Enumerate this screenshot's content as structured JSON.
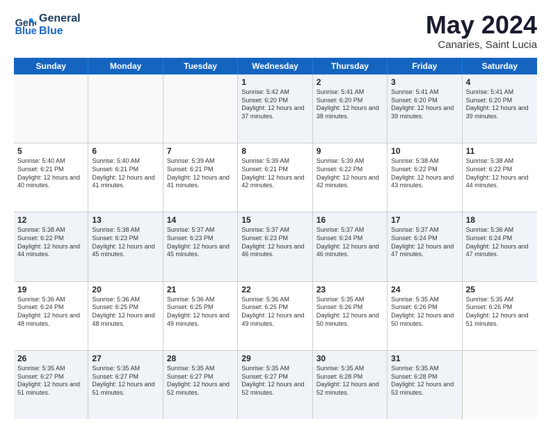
{
  "logo": {
    "text1": "General",
    "text2": "Blue"
  },
  "title": "May 2024",
  "subtitle": "Canaries, Saint Lucia",
  "days": [
    "Sunday",
    "Monday",
    "Tuesday",
    "Wednesday",
    "Thursday",
    "Friday",
    "Saturday"
  ],
  "rows": [
    [
      {
        "day": "",
        "sunrise": "",
        "sunset": "",
        "daylight": "",
        "empty": true
      },
      {
        "day": "",
        "sunrise": "",
        "sunset": "",
        "daylight": "",
        "empty": true
      },
      {
        "day": "",
        "sunrise": "",
        "sunset": "",
        "daylight": "",
        "empty": true
      },
      {
        "day": "1",
        "sunrise": "Sunrise: 5:42 AM",
        "sunset": "Sunset: 6:20 PM",
        "daylight": "Daylight: 12 hours and 37 minutes."
      },
      {
        "day": "2",
        "sunrise": "Sunrise: 5:41 AM",
        "sunset": "Sunset: 6:20 PM",
        "daylight": "Daylight: 12 hours and 38 minutes."
      },
      {
        "day": "3",
        "sunrise": "Sunrise: 5:41 AM",
        "sunset": "Sunset: 6:20 PM",
        "daylight": "Daylight: 12 hours and 39 minutes."
      },
      {
        "day": "4",
        "sunrise": "Sunrise: 5:41 AM",
        "sunset": "Sunset: 6:20 PM",
        "daylight": "Daylight: 12 hours and 39 minutes."
      }
    ],
    [
      {
        "day": "5",
        "sunrise": "Sunrise: 5:40 AM",
        "sunset": "Sunset: 6:21 PM",
        "daylight": "Daylight: 12 hours and 40 minutes."
      },
      {
        "day": "6",
        "sunrise": "Sunrise: 5:40 AM",
        "sunset": "Sunset: 6:21 PM",
        "daylight": "Daylight: 12 hours and 41 minutes."
      },
      {
        "day": "7",
        "sunrise": "Sunrise: 5:39 AM",
        "sunset": "Sunset: 6:21 PM",
        "daylight": "Daylight: 12 hours and 41 minutes."
      },
      {
        "day": "8",
        "sunrise": "Sunrise: 5:39 AM",
        "sunset": "Sunset: 6:21 PM",
        "daylight": "Daylight: 12 hours and 42 minutes."
      },
      {
        "day": "9",
        "sunrise": "Sunrise: 5:39 AM",
        "sunset": "Sunset: 6:22 PM",
        "daylight": "Daylight: 12 hours and 42 minutes."
      },
      {
        "day": "10",
        "sunrise": "Sunrise: 5:38 AM",
        "sunset": "Sunset: 6:22 PM",
        "daylight": "Daylight: 12 hours and 43 minutes."
      },
      {
        "day": "11",
        "sunrise": "Sunrise: 5:38 AM",
        "sunset": "Sunset: 6:22 PM",
        "daylight": "Daylight: 12 hours and 44 minutes."
      }
    ],
    [
      {
        "day": "12",
        "sunrise": "Sunrise: 5:38 AM",
        "sunset": "Sunset: 6:22 PM",
        "daylight": "Daylight: 12 hours and 44 minutes."
      },
      {
        "day": "13",
        "sunrise": "Sunrise: 5:38 AM",
        "sunset": "Sunset: 6:23 PM",
        "daylight": "Daylight: 12 hours and 45 minutes."
      },
      {
        "day": "14",
        "sunrise": "Sunrise: 5:37 AM",
        "sunset": "Sunset: 6:23 PM",
        "daylight": "Daylight: 12 hours and 45 minutes."
      },
      {
        "day": "15",
        "sunrise": "Sunrise: 5:37 AM",
        "sunset": "Sunset: 6:23 PM",
        "daylight": "Daylight: 12 hours and 46 minutes."
      },
      {
        "day": "16",
        "sunrise": "Sunrise: 5:37 AM",
        "sunset": "Sunset: 6:24 PM",
        "daylight": "Daylight: 12 hours and 46 minutes."
      },
      {
        "day": "17",
        "sunrise": "Sunrise: 5:37 AM",
        "sunset": "Sunset: 6:24 PM",
        "daylight": "Daylight: 12 hours and 47 minutes."
      },
      {
        "day": "18",
        "sunrise": "Sunrise: 5:36 AM",
        "sunset": "Sunset: 6:24 PM",
        "daylight": "Daylight: 12 hours and 47 minutes."
      }
    ],
    [
      {
        "day": "19",
        "sunrise": "Sunrise: 5:36 AM",
        "sunset": "Sunset: 6:24 PM",
        "daylight": "Daylight: 12 hours and 48 minutes."
      },
      {
        "day": "20",
        "sunrise": "Sunrise: 5:36 AM",
        "sunset": "Sunset: 6:25 PM",
        "daylight": "Daylight: 12 hours and 48 minutes."
      },
      {
        "day": "21",
        "sunrise": "Sunrise: 5:36 AM",
        "sunset": "Sunset: 6:25 PM",
        "daylight": "Daylight: 12 hours and 49 minutes."
      },
      {
        "day": "22",
        "sunrise": "Sunrise: 5:36 AM",
        "sunset": "Sunset: 6:25 PM",
        "daylight": "Daylight: 12 hours and 49 minutes."
      },
      {
        "day": "23",
        "sunrise": "Sunrise: 5:35 AM",
        "sunset": "Sunset: 6:26 PM",
        "daylight": "Daylight: 12 hours and 50 minutes."
      },
      {
        "day": "24",
        "sunrise": "Sunrise: 5:35 AM",
        "sunset": "Sunset: 6:26 PM",
        "daylight": "Daylight: 12 hours and 50 minutes."
      },
      {
        "day": "25",
        "sunrise": "Sunrise: 5:35 AM",
        "sunset": "Sunset: 6:26 PM",
        "daylight": "Daylight: 12 hours and 51 minutes."
      }
    ],
    [
      {
        "day": "26",
        "sunrise": "Sunrise: 5:35 AM",
        "sunset": "Sunset: 6:27 PM",
        "daylight": "Daylight: 12 hours and 51 minutes."
      },
      {
        "day": "27",
        "sunrise": "Sunrise: 5:35 AM",
        "sunset": "Sunset: 6:27 PM",
        "daylight": "Daylight: 12 hours and 51 minutes."
      },
      {
        "day": "28",
        "sunrise": "Sunrise: 5:35 AM",
        "sunset": "Sunset: 6:27 PM",
        "daylight": "Daylight: 12 hours and 52 minutes."
      },
      {
        "day": "29",
        "sunrise": "Sunrise: 5:35 AM",
        "sunset": "Sunset: 6:27 PM",
        "daylight": "Daylight: 12 hours and 52 minutes."
      },
      {
        "day": "30",
        "sunrise": "Sunrise: 5:35 AM",
        "sunset": "Sunset: 6:28 PM",
        "daylight": "Daylight: 12 hours and 52 minutes."
      },
      {
        "day": "31",
        "sunrise": "Sunrise: 5:35 AM",
        "sunset": "Sunset: 6:28 PM",
        "daylight": "Daylight: 12 hours and 53 minutes."
      },
      {
        "day": "",
        "sunrise": "",
        "sunset": "",
        "daylight": "",
        "empty": true
      }
    ]
  ],
  "altRows": [
    0,
    2,
    4
  ]
}
